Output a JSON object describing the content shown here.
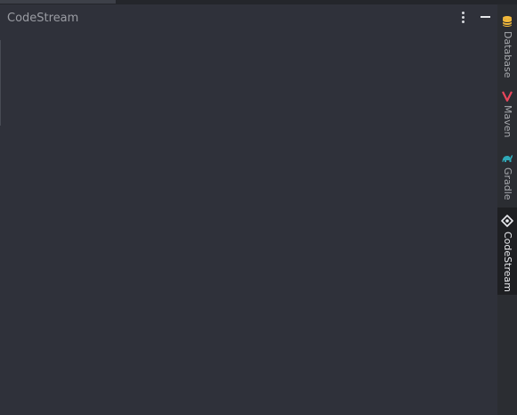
{
  "panel": {
    "title": "CodeStream"
  },
  "icons": {
    "more": "more-vertical-icon",
    "minimize": "minimize-icon"
  },
  "stripe": {
    "items": [
      {
        "label": "Database",
        "icon": "database-icon",
        "color": "#f2b93b"
      },
      {
        "label": "Maven",
        "icon": "maven-icon",
        "color": "#e8465b"
      },
      {
        "label": "Gradle",
        "icon": "gradle-icon",
        "color": "#2fa9b8"
      },
      {
        "label": "CodeStream",
        "icon": "codestream-icon",
        "color": "#e9eaee",
        "active": true
      }
    ]
  }
}
